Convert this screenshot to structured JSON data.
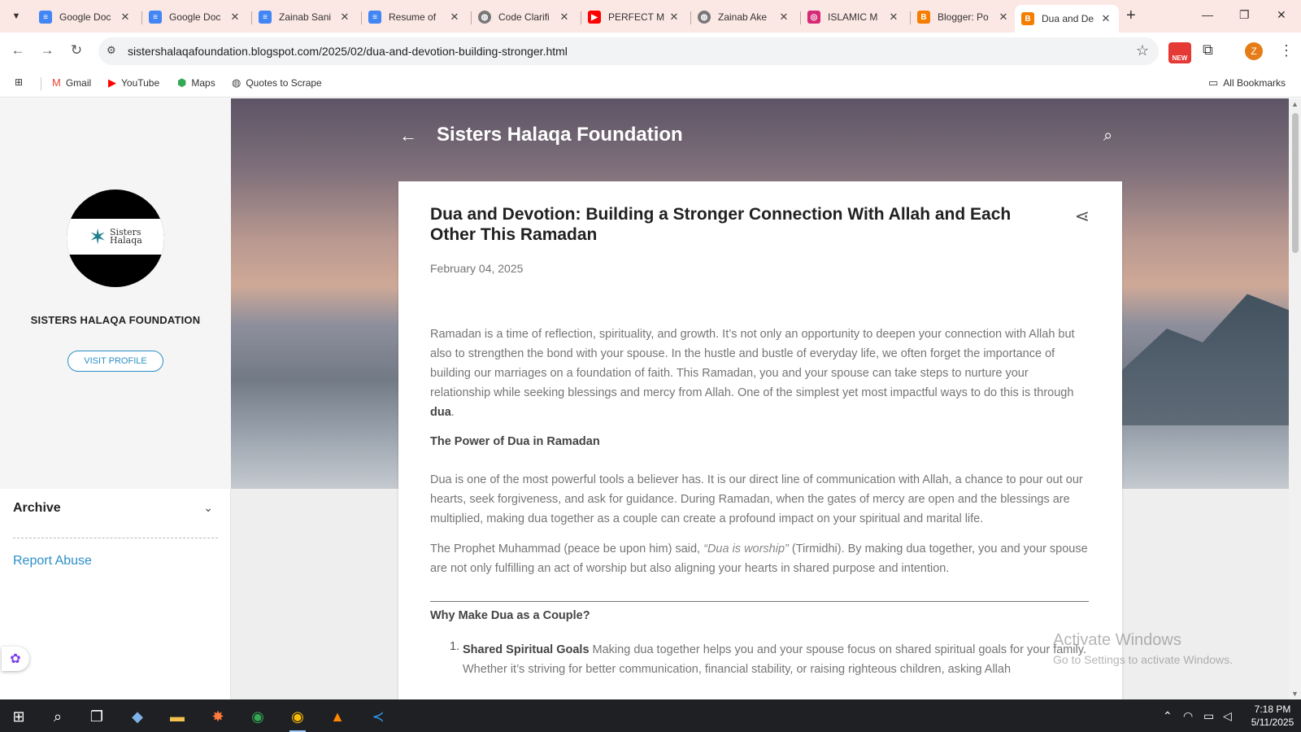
{
  "browser": {
    "tabs": [
      {
        "title": "Google Doc",
        "icon": "docs-icon",
        "color": "#4285f4"
      },
      {
        "title": "Google Doc",
        "icon": "docs-icon",
        "color": "#4285f4"
      },
      {
        "title": "Zainab Sani",
        "icon": "docs-icon",
        "color": "#4285f4"
      },
      {
        "title": "Resume of",
        "icon": "docs-icon",
        "color": "#4285f4"
      },
      {
        "title": "Code Clarifi",
        "icon": "globe-icon",
        "color": "#555555"
      },
      {
        "title": "PERFECT M",
        "icon": "youtube-icon",
        "color": "#ff0000"
      },
      {
        "title": "Zainab Ake",
        "icon": "globe-icon",
        "color": "#555555"
      },
      {
        "title": "ISLAMIC M",
        "icon": "instagram-icon",
        "color": "#d62976"
      },
      {
        "title": "Blogger: Po",
        "icon": "blogger-icon",
        "color": "#f57d00"
      },
      {
        "title": "Dua and De",
        "icon": "blogger-icon",
        "color": "#f57d00",
        "active": true
      }
    ],
    "url": "sistershalaqafoundation.blogspot.com/2025/02/dua-and-devotion-building-stronger.html",
    "profile_initial": "Z",
    "extension_badge": "NEW",
    "bookmarks": [
      {
        "label": "Gmail",
        "icon": "gmail-icon"
      },
      {
        "label": "YouTube",
        "icon": "youtube-icon"
      },
      {
        "label": "Maps",
        "icon": "maps-icon"
      },
      {
        "label": "Quotes to Scrape",
        "icon": "globe-icon"
      }
    ],
    "all_bookmarks": "All Bookmarks"
  },
  "sidebar": {
    "site_name": "SISTERS HALAQA FOUNDATION",
    "visit_profile": "VISIT PROFILE",
    "archive": "Archive",
    "report_abuse": "Report Abuse",
    "logo_text_1": "Sisters",
    "logo_text_2": "Halaqa"
  },
  "header": {
    "blog_title": "Sisters Halaqa Foundation"
  },
  "post": {
    "title": "Dua and Devotion: Building a Stronger Connection With Allah and Each Other This Ramadan",
    "date": "February 04, 2025",
    "para1": "Ramadan is a time of reflection, spirituality, and growth. It’s not only an opportunity to deepen your connection with Allah but also to strengthen the bond with your spouse. In the hustle and bustle of everyday life, we often forget the importance of building our marriages on a foundation of faith. This Ramadan, you and your spouse can take steps to nurture your relationship while seeking blessings and mercy from Allah. One of the simplest yet most impactful ways to do this is through ",
    "para1_bold": "dua",
    "para1_end": ".",
    "heading1": "The Power of Dua in Ramadan",
    "para2": "Dua is one of the most powerful tools a believer has. It is our direct line of communication with Allah, a chance to pour out our hearts, seek forgiveness, and ask for guidance. During Ramadan, when the gates of mercy are open and the blessings are multiplied, making dua together as a couple can create a profound impact on your spiritual and marital life.",
    "para3_start": "The Prophet Muhammad (peace be upon him) said, ",
    "para3_quote": "“Dua is worship”",
    "para3_end": " (Tirmidhi). By making dua together, you and your spouse are not only fulfilling an act of worship but also aligning your hearts in shared purpose and intention.",
    "heading2": "Why Make Dua as a Couple?",
    "list_number": "1.",
    "list1_bold": "Shared Spiritual Goals",
    "list1_text": " Making dua together helps you and your spouse focus on shared spiritual goals for your family. Whether it’s striving for better communication, financial stability, or raising righteous children, asking Allah"
  },
  "watermark": {
    "line1": "Activate Windows",
    "line2": "Go to Settings to activate Windows."
  },
  "taskbar": {
    "time": "7:18 PM",
    "date": "5/11/2025"
  }
}
